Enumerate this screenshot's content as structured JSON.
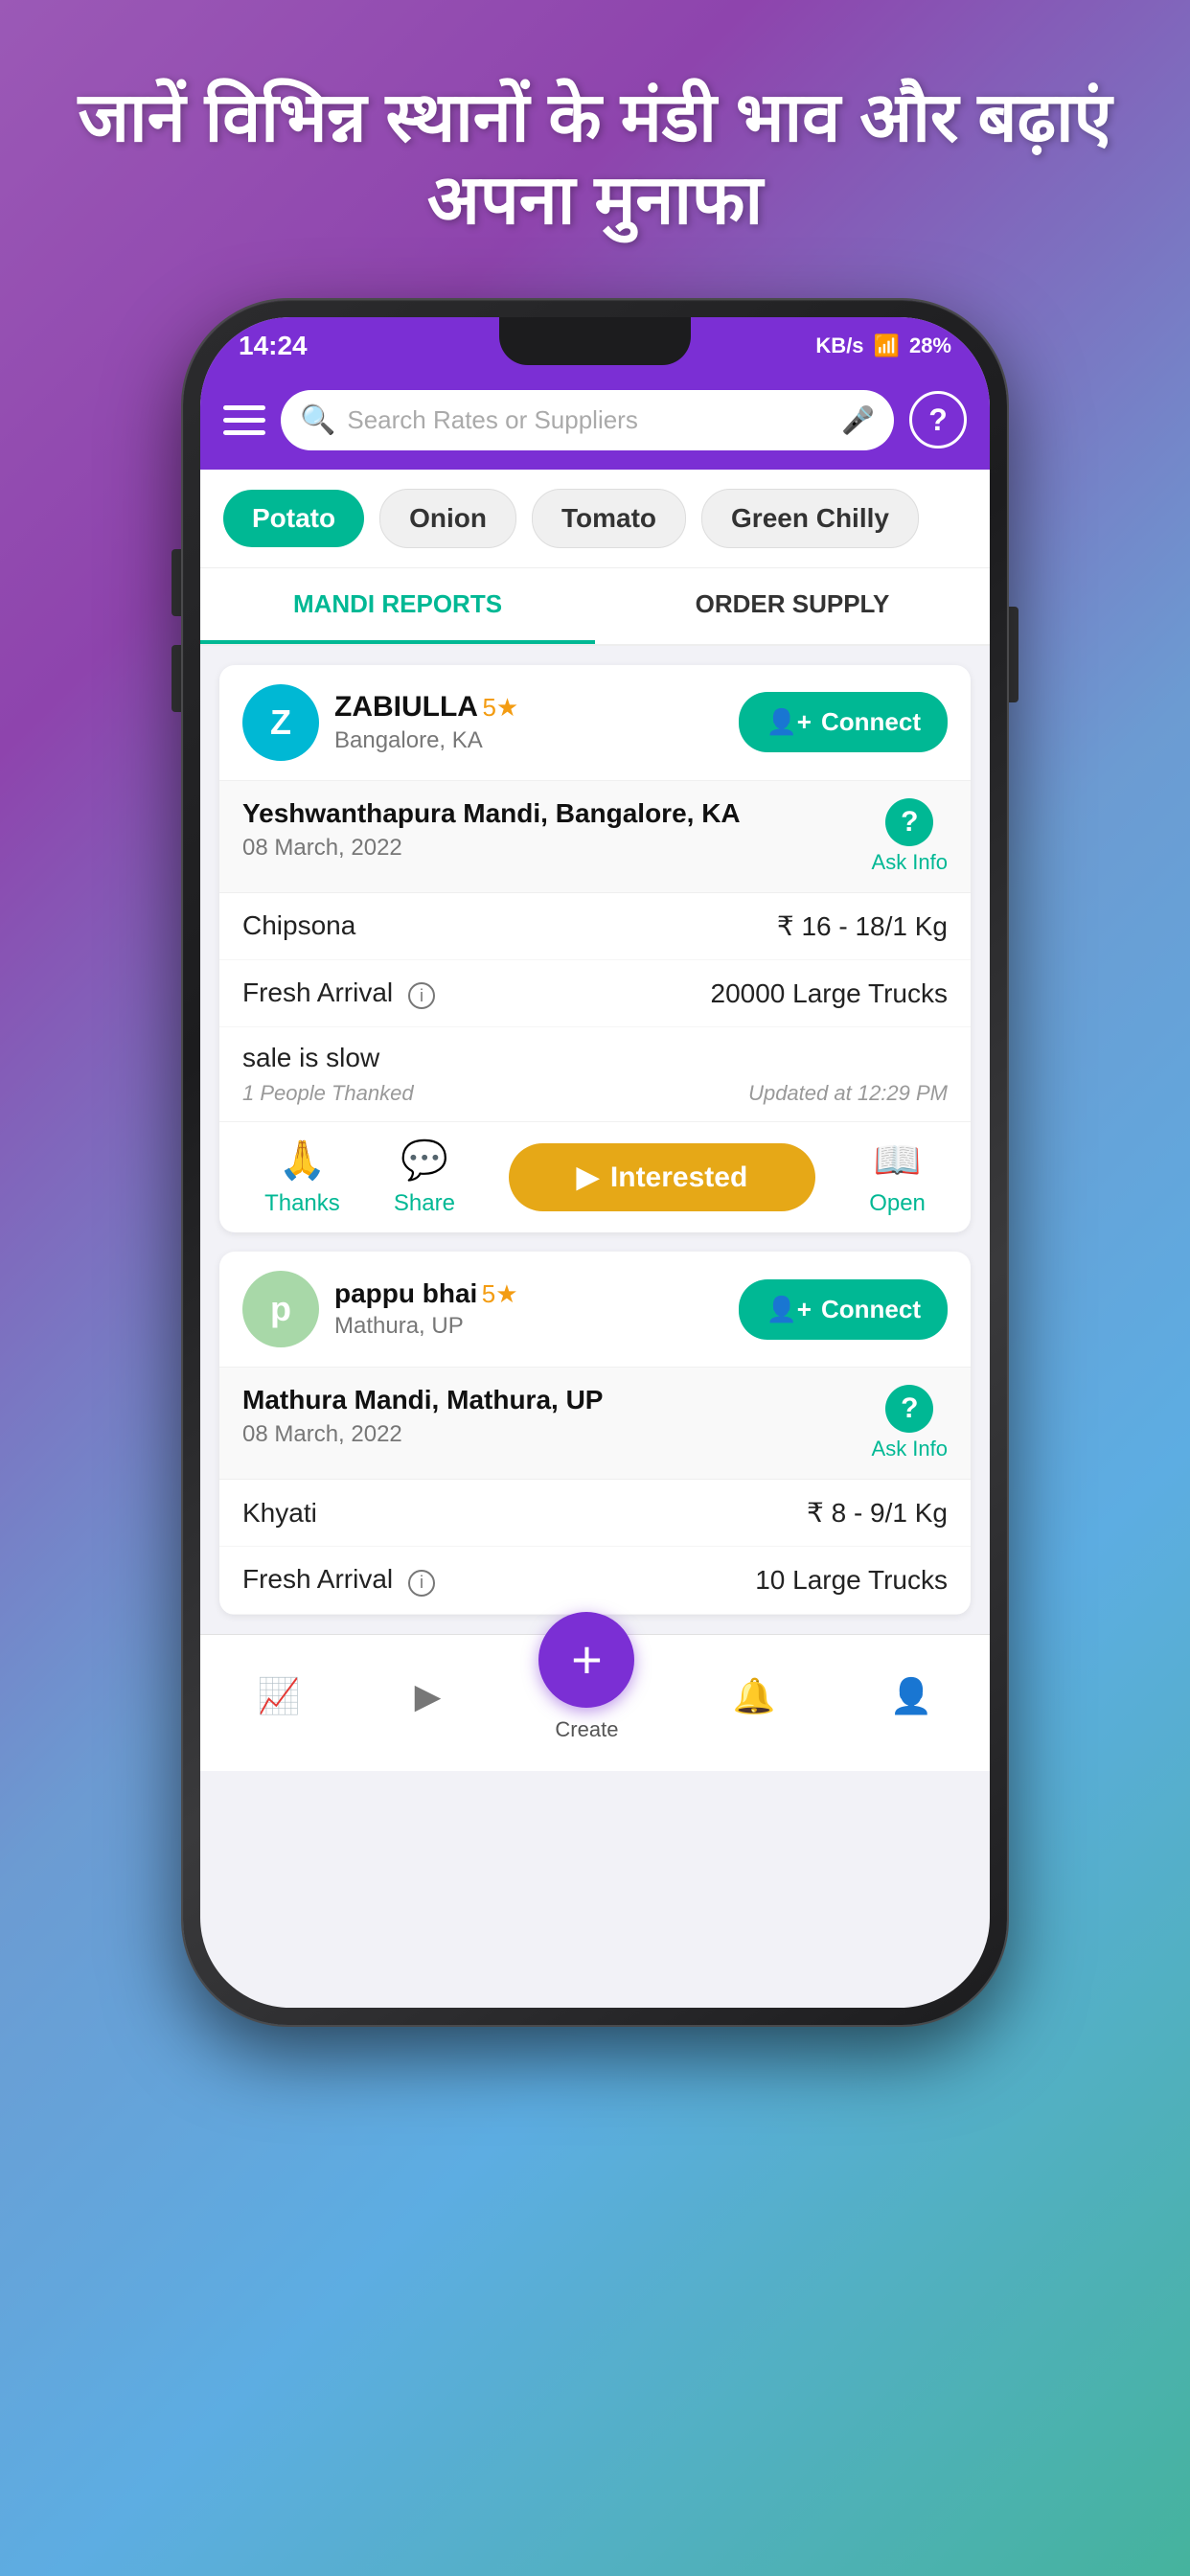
{
  "hero": {
    "title": "जानें विभिन्न स्थानों के मंडी भाव और बढ़ाएं अपना मुनाफा"
  },
  "status_bar": {
    "time": "14:24",
    "signal": "KB/s",
    "wifi": "WiFi",
    "battery": "28%"
  },
  "header": {
    "search_placeholder": "Search Rates or Suppliers",
    "help_label": "?"
  },
  "categories": [
    {
      "label": "Potato",
      "active": true
    },
    {
      "label": "Onion",
      "active": false
    },
    {
      "label": "Tomato",
      "active": false
    },
    {
      "label": "Green Chilly",
      "active": false
    }
  ],
  "tabs": [
    {
      "label": "MANDI REPORTS",
      "active": true
    },
    {
      "label": "ORDER SUPPLY",
      "active": false
    }
  ],
  "cards": [
    {
      "avatar_letter": "Z",
      "avatar_color": "teal",
      "seller_name": "ZABIULLA",
      "seller_rating": "5★",
      "seller_location": "Bangalore, KA",
      "connect_label": "Connect",
      "mandi_name": "Yeshwanthapura Mandi, Bangalore, KA",
      "mandi_date": "08 March, 2022",
      "ask_info_label": "Ask Info",
      "variety": "Chipsona",
      "price": "₹ 16 - 18/1 Kg",
      "arrival_label": "Fresh Arrival",
      "arrival_value": "20000 Large Trucks",
      "note": "sale is slow",
      "thanked": "1 People Thanked",
      "updated": "Updated at 12:29 PM",
      "actions": {
        "thanks_label": "Thanks",
        "thanks_icon": "🙏",
        "share_label": "Share",
        "share_icon": "💬",
        "interested_label": "Interested",
        "interested_arrow": "▶",
        "open_label": "Open",
        "open_icon": "📖"
      }
    },
    {
      "avatar_letter": "p",
      "avatar_color": "green",
      "seller_name": "pappu bhai",
      "seller_rating": "5★",
      "seller_location": "Mathura, UP",
      "connect_label": "Connect",
      "mandi_name": "Mathura Mandi, Mathura, UP",
      "mandi_date": "08 March, 2022",
      "ask_info_label": "Ask Info",
      "variety": "Khyati",
      "price": "₹ 8 - 9/1 Kg",
      "arrival_label": "Fresh Arrival",
      "arrival_value": "10 Large Trucks"
    }
  ],
  "bottom_nav": {
    "items": [
      {
        "icon": "📈",
        "label": ""
      },
      {
        "icon": "▶",
        "label": ""
      },
      {
        "icon": "+",
        "label": "Create",
        "fab": true
      },
      {
        "icon": "🔔",
        "label": ""
      },
      {
        "icon": "👤",
        "label": ""
      }
    ]
  }
}
